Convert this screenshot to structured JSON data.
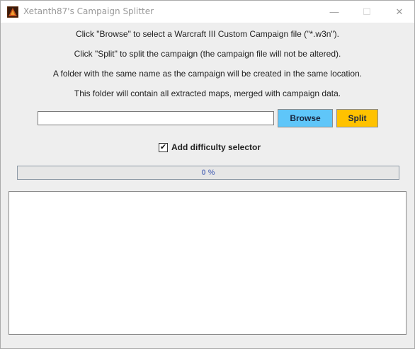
{
  "window": {
    "title": "Xetanth87's Campaign Splitter",
    "icon": "warcraft-app-icon",
    "minimize_glyph": "—",
    "maximize_glyph": "☐",
    "close_glyph": "✕"
  },
  "instructions": [
    "Click \"Browse\" to select a Warcraft III Custom Campaign file (\"*.w3n\").",
    "Click \"Split\" to split the campaign (the campaign file will not be altered).",
    "A folder with the same name as the campaign will be created in the same location.",
    "This folder will contain all extracted maps, merged with campaign data."
  ],
  "file_input": {
    "value": "",
    "placeholder": ""
  },
  "buttons": {
    "browse_label": "Browse",
    "split_label": "Split",
    "browse_color": "#5fc6f9",
    "split_color": "#ffc200"
  },
  "difficulty": {
    "label": "Add difficulty selector",
    "checked": true,
    "check_glyph": "✔"
  },
  "progress": {
    "percent": 0,
    "text": "0 %"
  },
  "log": {
    "text": ""
  }
}
